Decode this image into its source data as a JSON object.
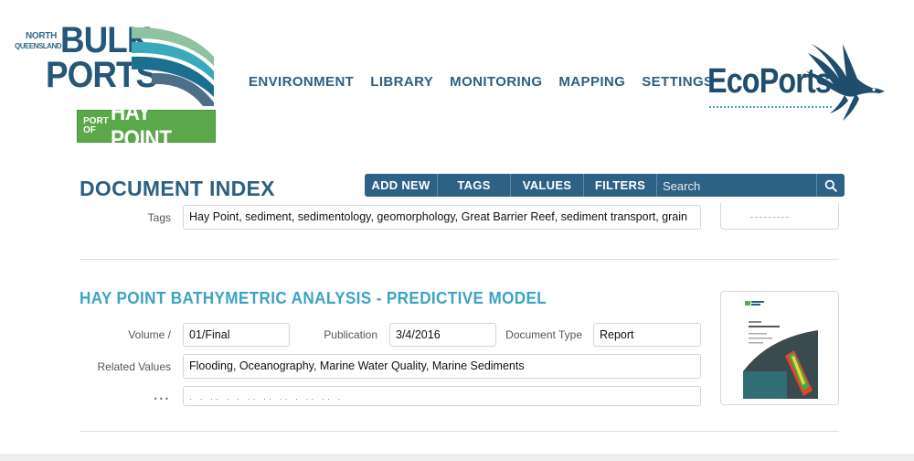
{
  "brand": {
    "north": "NORTH",
    "queensland": "QUEENSLAND",
    "bulk": "BULK",
    "ports": "PORTS",
    "port_of": "PORT OF",
    "hay_point": "HAY POINT",
    "ecoports": "EcoPorts"
  },
  "nav": {
    "items": [
      "ENVIRONMENT",
      "LIBRARY",
      "MONITORING",
      "MAPPING",
      "SETTINGS"
    ]
  },
  "page": {
    "title": "DOCUMENT INDEX"
  },
  "toolbar": {
    "add_new": "ADD NEW",
    "tags": "TAGS",
    "values": "VALUES",
    "filters": "FILTERS",
    "search_placeholder": "Search",
    "search_icon": "search-icon"
  },
  "record_prev": {
    "tags_label": "Tags",
    "tags_value": "Hay Point, sediment, sedimentology, geomorphology, Great Barrier Reef, sediment transport, grain"
  },
  "record": {
    "title": "HAY POINT BATHYMETRIC ANALYSIS - PREDICTIVE MODEL",
    "volume_label": "Volume /",
    "volume_value": "01/Final",
    "publication_label": "Publication",
    "publication_value": "3/4/2016",
    "doctype_label": "Document Type",
    "doctype_value": "Report",
    "related_label": "Related Values",
    "related_value": "Flooding, Oceanography, Marine Water Quality, Marine Sediments"
  },
  "colors": {
    "brand_blue": "#2c5f84",
    "title_teal": "#3ba3c4",
    "hay_point_green": "#5aa84a",
    "toolbar_bg": "#2d6185"
  }
}
